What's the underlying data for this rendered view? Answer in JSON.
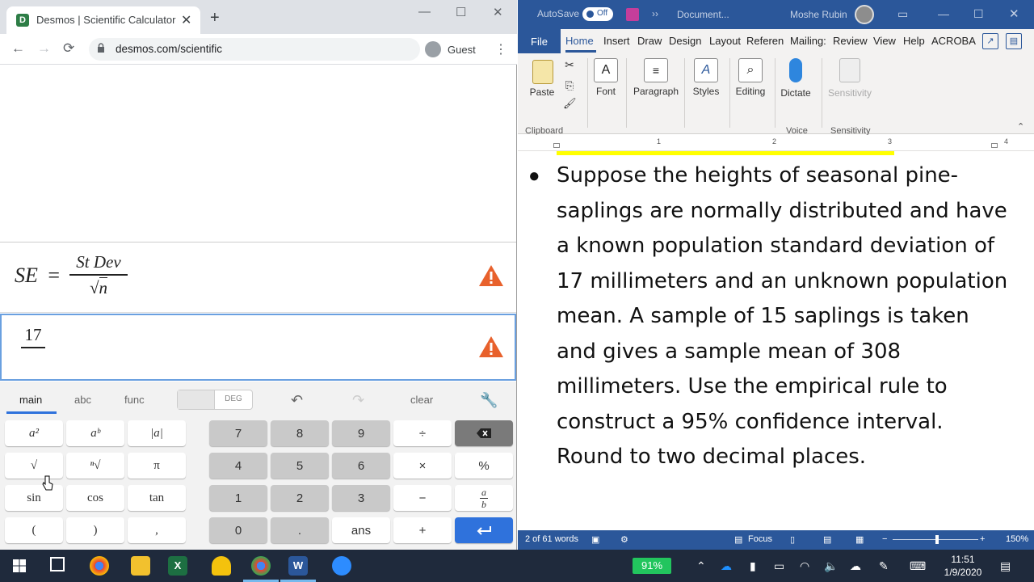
{
  "chrome": {
    "tab_title": "Desmos | Scientific Calculator",
    "new_tab": "+",
    "url": "desmos.com/scientific",
    "profile": "Guest",
    "win_min": "—",
    "win_max": "☐",
    "win_close": "✕",
    "favicon_letter": "D"
  },
  "desmos": {
    "expr1": {
      "lhs": "SE",
      "eq": "=",
      "numerator": "St Dev",
      "denominator": "n"
    },
    "expr2": {
      "numerator": "17"
    },
    "tabs": {
      "main": "main",
      "abc": "abc",
      "func": "func"
    },
    "deg_label": "DEG",
    "clear_label": "clear",
    "keys": {
      "a2": "a²",
      "ab": "aᵇ",
      "abs": "|a|",
      "sqrt": "√",
      "nroot": "ⁿ√",
      "pi": "π",
      "sin": "sin",
      "cos": "cos",
      "tan": "tan",
      "lparen": "(",
      "rparen": ")",
      "comma": ",",
      "k7": "7",
      "k8": "8",
      "k9": "9",
      "div": "÷",
      "k4": "4",
      "k5": "5",
      "k6": "6",
      "times": "×",
      "percent": "%",
      "k1": "1",
      "k2": "2",
      "k3": "3",
      "minus": "−",
      "frac_a": "a",
      "frac_b": "b",
      "k0": "0",
      "dot": ".",
      "ans": "ans",
      "plus": "+"
    }
  },
  "word": {
    "autosave": "AutoSave",
    "autosave_state": "Off",
    "doc_name": "Document...",
    "user_name": "Moshe Rubin",
    "menu": {
      "file": "File",
      "home": "Home",
      "insert": "Insert",
      "draw": "Draw",
      "design": "Design",
      "layout": "Layout",
      "references": "Referen",
      "mailings": "Mailing:",
      "review": "Review",
      "view": "View",
      "help": "Help",
      "acrobat": "ACROBA"
    },
    "ribbon": {
      "paste": "Paste",
      "font": "Font",
      "paragraph": "Paragraph",
      "styles": "Styles",
      "editing": "Editing",
      "dictate": "Dictate",
      "sensitivity": "Sensitivity",
      "group_clipboard": "Clipboard",
      "group_voice": "Voice",
      "group_sensitivity": "Sensitivity"
    },
    "ruler": [
      "1",
      "2",
      "3",
      "4"
    ],
    "document_text": "Suppose the heights of seasonal pine-saplings are normally distributed and have a known population standard deviation of 17 millimeters and an unknown population mean. A sample of 15 saplings is taken and gives a sample mean of 308 millimeters. Use the empirical rule to construct a 95% confidence interval. Round to two decimal places.",
    "status": {
      "words": "2 of 61 words",
      "focus": "Focus",
      "zoom": "150%"
    }
  },
  "taskbar": {
    "battery": "91%",
    "time": "11:51",
    "date": "1/9/2020"
  },
  "colors": {
    "word_blue": "#2b579a",
    "desmos_blue": "#2f72dc",
    "warning_orange": "#e8612c",
    "highlight_yellow": "#ffff00"
  }
}
